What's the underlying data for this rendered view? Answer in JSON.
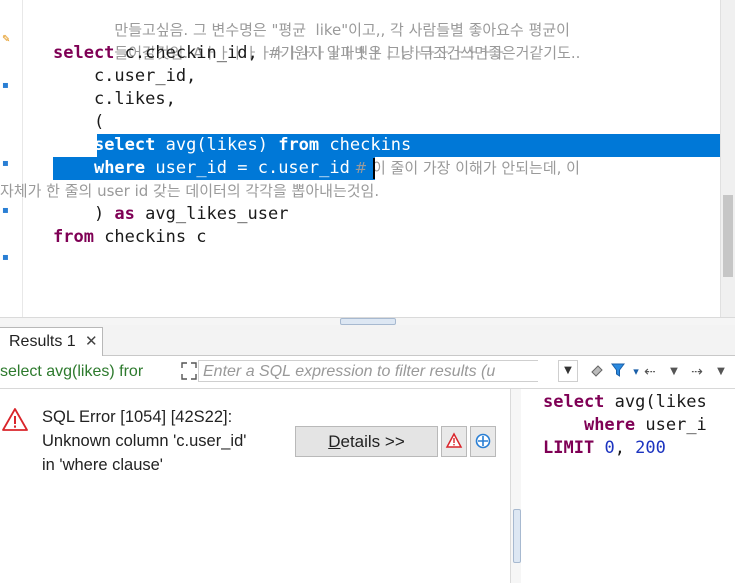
{
  "editor": {
    "lines": {
      "l1": "만들고싶음. 그 변수명은 \"평균  like\"이고,, 각 사람들별 좋아요수 평균이",
      "l2": "들어갈것임. Aㅏㅏㅏㅏㅏㅏㅏㅏㅏㅏㅏㅏㅏㅏㅏㅏㅏㅏㅏㅏㅏㅏ",
      "l3_kw": "select",
      "l3_code": " c.checkin_id, ",
      "l3_cm": "#기원지 알파벳은 그냥 무조건쓰면좋은거같기도..",
      "l4": "    c.user_id,",
      "l5": "    c.likes,",
      "l6": "    (",
      "l7_indent": "    ",
      "l7_kw1": "select",
      "l7_mid": " avg(likes) ",
      "l7_kw2": "from",
      "l7_end": " checkins",
      "l8_indent": "    ",
      "l8_kw": "where",
      "l8_code": " user_id = c.user_id",
      "l8_cm": " # 이 줄이 가장 이해가 안되는데, 이",
      "l9_cm": "자체가 한 줄의 user id 갖는 데이터의 각각을 뽑아내는것임.",
      "l10_a": "    ) ",
      "l10_kw": "as",
      "l10_b": " avg_likes_user",
      "l11_kw": "from",
      "l11_code": " checkins c"
    }
  },
  "results": {
    "tab_label": "Results 1",
    "tab_close": "✕",
    "filter_sql_text": "select avg(likes) fror",
    "filter_placeholder": "Enter a SQL expression to filter results (u",
    "error": {
      "line1": "SQL Error [1054] [42S22]:",
      "line2": "Unknown column 'c.user_id'",
      "line3": "in 'where clause'"
    },
    "details_label_u": "D",
    "details_label_rest": "etails >>",
    "preview": {
      "q1_kw1": "select",
      "q1_code": " avg(likes",
      "q2_indent": "    ",
      "q2_kw": "where",
      "q2_code": " user_i",
      "q3_kw": "LIMIT",
      "q3_sp": " ",
      "q3_n1": "0",
      "q3_comma": ", ",
      "q3_n2": "200"
    }
  },
  "colors": {
    "keyword": "#7f0055",
    "selection": "#0078d7",
    "filter_sql": "#2d7a2d",
    "number": "#1c34c0",
    "error_red": "#d9252b"
  },
  "icons": [
    "error-triangle-icon",
    "warning-icon",
    "crosshair-icon",
    "eraser-icon",
    "filter-icon",
    "arrow-left-icon",
    "arrow-right-icon",
    "dropdown-icon",
    "expand-icon",
    "close-icon"
  ]
}
